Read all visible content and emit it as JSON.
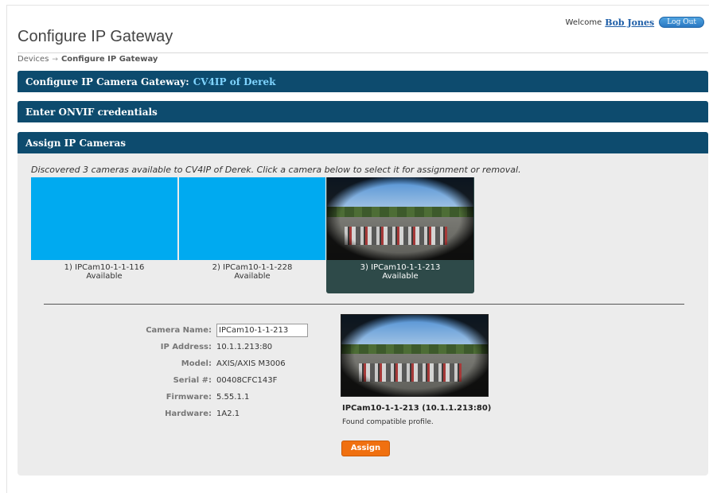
{
  "header": {
    "welcome_text": "Welcome",
    "user_name": "Bob Jones",
    "logout_label": "Log Out",
    "page_title": "Configure IP Gateway"
  },
  "breadcrumb": {
    "root": "Devices",
    "separator": "→",
    "current": "Configure IP Gateway"
  },
  "panels": {
    "gateway_label": "Configure IP Camera Gateway:",
    "gateway_name": "CV4IP of Derek",
    "onvif_label": "Enter ONVIF credentials",
    "assign_label": "Assign IP Cameras"
  },
  "discovered_text": "Discovered 3 cameras available to CV4IP of Derek. Click a camera below to select it for assignment or removal.",
  "cameras": [
    {
      "name": "1) IPCam10-1-1-116",
      "status": "Available",
      "selected": false
    },
    {
      "name": "2) IPCam10-1-1-228",
      "status": "Available",
      "selected": false
    },
    {
      "name": "3) IPCam10-1-1-213",
      "status": "Available",
      "selected": true
    }
  ],
  "details": {
    "camera_name_label": "Camera Name:",
    "camera_name_value": "IPCam10-1-1-213",
    "ip_label": "IP Address:",
    "ip_value": "10.1.1.213:80",
    "model_label": "Model:",
    "model_value": "AXIS/AXIS M3006",
    "serial_label": "Serial #:",
    "serial_value": "00408CFC143F",
    "firmware_label": "Firmware:",
    "firmware_value": "5.55.1.1",
    "hardware_label": "Hardware:",
    "hardware_value": "1A2.1"
  },
  "preview": {
    "title": "IPCam10-1-1-213 (10.1.1.213:80)",
    "message": "Found compatible profile.",
    "assign_label": "Assign"
  },
  "colors": {
    "panel_bar": "#0d4b6e",
    "accent_text": "#7fd4ff",
    "camera_placeholder": "#00aaf0",
    "selected_camera": "#2e4a49",
    "assign_button": "#f07010"
  }
}
